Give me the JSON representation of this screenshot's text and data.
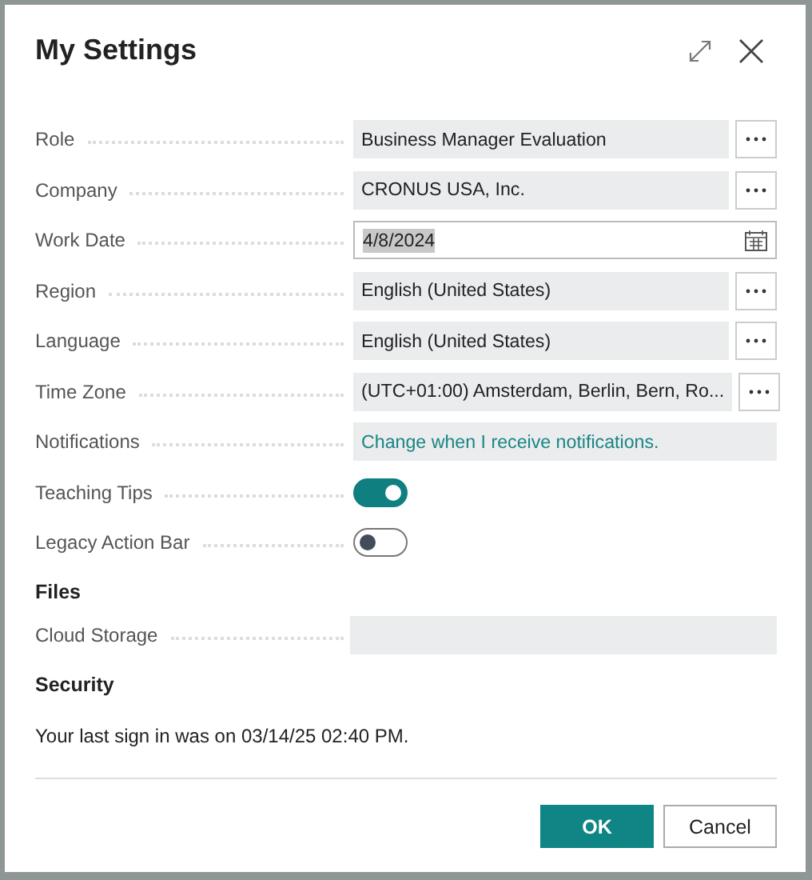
{
  "dialog": {
    "title": "My Settings"
  },
  "fields": [
    {
      "label": "Role",
      "kind": "lookup",
      "value": "Business Manager Evaluation"
    },
    {
      "label": "Company",
      "kind": "lookup",
      "value": "CRONUS USA, Inc."
    },
    {
      "label": "Work Date",
      "kind": "date",
      "value": "4/8/2024",
      "value_selected": true
    },
    {
      "label": "Region",
      "kind": "lookup",
      "value": "English (United States)"
    },
    {
      "label": "Language",
      "kind": "lookup",
      "value": "English (United States)"
    },
    {
      "label": "Time Zone",
      "kind": "lookup",
      "value": "(UTC+01:00) Amsterdam, Berlin, Bern, Ro..."
    },
    {
      "label": "Notifications",
      "kind": "link",
      "value": "Change when I receive notifications."
    },
    {
      "label": "Teaching Tips",
      "kind": "toggle",
      "on": true
    },
    {
      "label": "Legacy Action Bar",
      "kind": "toggle",
      "on": false
    }
  ],
  "sections": [
    {
      "heading": "Files",
      "fields": [
        {
          "label": "Cloud Storage",
          "kind": "blank"
        }
      ]
    },
    {
      "heading": "Security",
      "text": "Your last sign in was on 03/14/25 02:40 PM."
    }
  ],
  "buttons": [
    {
      "label": "OK",
      "primary": true
    },
    {
      "label": "Cancel",
      "primary": false
    }
  ]
}
